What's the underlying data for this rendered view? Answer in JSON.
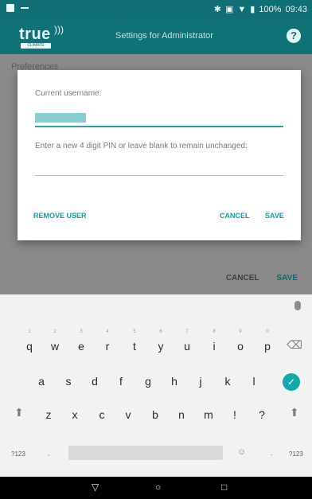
{
  "status_bar": {
    "battery": "100%",
    "time": "09:43"
  },
  "app_bar": {
    "logo_text": "true",
    "logo_sub": "CLIMATE",
    "title": "Settings for Administrator",
    "help_icon": "help-icon"
  },
  "background": {
    "preferences_label": "Preferences",
    "cancel": "CANCEL",
    "save": "SAVE"
  },
  "dialog": {
    "current_username_label": "Current username:",
    "pin_label": "Enter a new 4 digit PIN or leave blank to remain unchanged:",
    "remove_user": "REMOVE USER",
    "cancel": "CANCEL",
    "save": "SAVE"
  },
  "keyboard": {
    "row1": [
      {
        "k": "q",
        "n": "1"
      },
      {
        "k": "w",
        "n": "2"
      },
      {
        "k": "e",
        "n": "3"
      },
      {
        "k": "r",
        "n": "4"
      },
      {
        "k": "t",
        "n": "5"
      },
      {
        "k": "y",
        "n": "6"
      },
      {
        "k": "u",
        "n": "7"
      },
      {
        "k": "i",
        "n": "8"
      },
      {
        "k": "o",
        "n": "9"
      },
      {
        "k": "p",
        "n": "0"
      }
    ],
    "row2": [
      "a",
      "s",
      "d",
      "f",
      "g",
      "h",
      "j",
      "k",
      "l"
    ],
    "row3": [
      "z",
      "x",
      "c",
      "v",
      "b",
      "n",
      "m",
      "!",
      "?"
    ],
    "symbols_label": "?123",
    "comma": ",",
    "period": ".",
    "backspace_icon": "⌫",
    "enter_icon": "✓",
    "shift_icon": "⬆",
    "emoji_icon": "☺"
  },
  "nav": {
    "back": "▽",
    "home": "○",
    "recents": "□"
  }
}
